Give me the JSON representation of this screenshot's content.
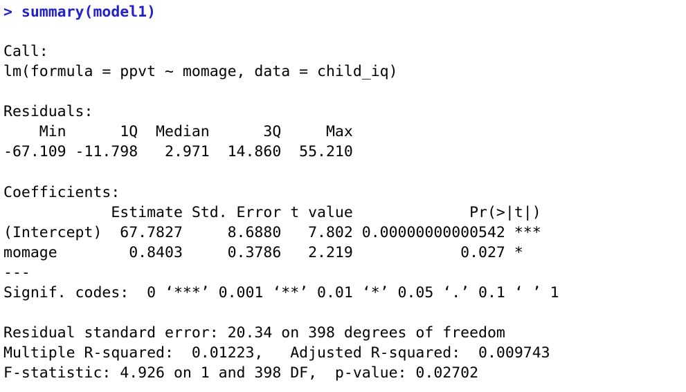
{
  "console": {
    "kind": "r-console-output",
    "background_color": "#ffffff",
    "text_color": "#000000",
    "prompt_color": "#2222c8",
    "command_line": "> summary(model1)",
    "call": {
      "heading": "Call:",
      "formula_line": "lm(formula = ppvt ~ momage, data = child_iq)"
    },
    "residuals": {
      "heading": "Residuals:",
      "header_line": "    Min      1Q  Median      3Q     Max ",
      "values_line": "-67.109 -11.798   2.971  14.860  55.210 ",
      "labels": [
        "Min",
        "1Q",
        "Median",
        "3Q",
        "Max"
      ],
      "values": [
        "-67.109",
        "-11.798",
        "2.971",
        "14.860",
        "55.210"
      ]
    },
    "coefficients": {
      "heading": "Coefficients:",
      "header_line": "            Estimate Std. Error t value             Pr(>|t|)    ",
      "columns": [
        "",
        "Estimate",
        "Std. Error",
        "t value",
        "Pr(>|t|)",
        ""
      ],
      "rows": [
        {
          "line": "(Intercept)  67.7827     8.6880   7.802 0.00000000000542 ***",
          "term": "(Intercept)",
          "estimate": "67.7827",
          "std_error": "8.6880",
          "t_value": "7.802",
          "p_value": "0.00000000000542",
          "signif": "***"
        },
        {
          "line": "momage        0.8403     0.3786   2.219            0.027 *  ",
          "term": "momage",
          "estimate": "0.8403",
          "std_error": "0.3786",
          "t_value": "2.219",
          "p_value": "0.027",
          "signif": "*"
        }
      ],
      "separator": "---",
      "signif_codes_line": "Signif. codes:  0 ‘***’ 0.001 ‘**’ 0.01 ‘*’ 0.05 ‘.’ 0.1 ‘ ’ 1"
    },
    "fit_statistics": {
      "residual_standard_error_line": "Residual standard error: 20.34 on 398 degrees of freedom",
      "r_squared_line": "Multiple R-squared:  0.01223,   Adjusted R-squared:  0.009743 ",
      "f_statistic_line": "F-statistic: 4.926 on 1 and 398 DF,  p-value: 0.02702",
      "residual_standard_error": "20.34",
      "residual_df": "398",
      "multiple_r_squared": "0.01223",
      "adjusted_r_squared": "0.009743",
      "f_statistic": "4.926",
      "f_df1": "1",
      "f_df2": "398",
      "p_value": "0.02702"
    }
  }
}
